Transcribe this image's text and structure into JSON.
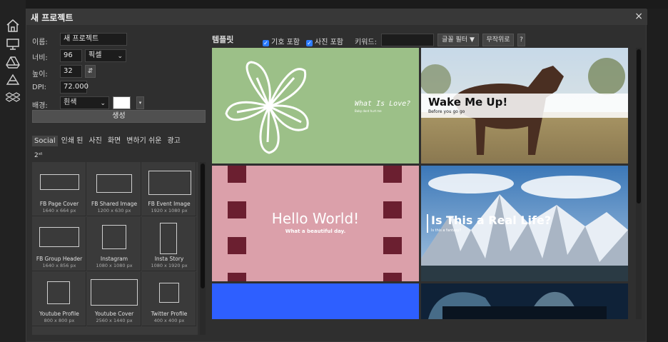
{
  "sidebar": {
    "icons": [
      "home-icon",
      "monitor-icon",
      "drive-icon",
      "drive-outline-icon",
      "dropbox-icon"
    ]
  },
  "dialog": {
    "title": "새 프로젝트",
    "close": "×"
  },
  "form": {
    "name_label": "이름:",
    "name_value": "새 프로젝트",
    "width_label": "너비:",
    "width_value": "96",
    "unit_value": "픽셀",
    "height_label": "높이:",
    "height_value": "32",
    "swap_icon": "⇵",
    "dpi_label": "DPI:",
    "dpi_value": "72.000",
    "bg_label": "배경:",
    "bg_value": "흰색",
    "bg_color": "#ffffff",
    "create_label": "생성"
  },
  "tabs": [
    {
      "label": "Social",
      "active": true
    },
    {
      "label": "인쇄 된",
      "active": false
    },
    {
      "label": "사진",
      "active": false
    },
    {
      "label": "화면",
      "active": false
    },
    {
      "label": "변하기 쉬운",
      "active": false
    },
    {
      "label": "광고",
      "active": false
    },
    {
      "label": "2ˢᵗ",
      "active": false
    }
  ],
  "presets": [
    {
      "name": "FB Page Cover",
      "size": "1640 x 664 px"
    },
    {
      "name": "FB Shared Image",
      "size": "1200 x 630 px"
    },
    {
      "name": "FB Event Image",
      "size": "1920 x 1080 px"
    },
    {
      "name": "FB Group Header",
      "size": "1640 x 856 px"
    },
    {
      "name": "Instagram",
      "size": "1080 x 1080 px"
    },
    {
      "name": "Insta Story",
      "size": "1080 x 1920 px"
    },
    {
      "name": "Youtube Profile",
      "size": "800 x 800 px"
    },
    {
      "name": "Youtube Cover",
      "size": "2560 x 1440 px"
    },
    {
      "name": "Twitter Profile",
      "size": "400 x 400 px"
    }
  ],
  "templates_bar": {
    "title": "템플릿",
    "include_symbols": "기호 포함",
    "include_photos": "사진 포함",
    "keyword_label": "키워드:",
    "keyword_value": "",
    "font_filter": "글꼴 필터 ▼",
    "random": "무작위로",
    "help": "?"
  },
  "templates": [
    {
      "title": "What Is Love?",
      "subtitle": "Baby dont hurt me",
      "bg": "#9cc088"
    },
    {
      "title": "Wake Me Up!",
      "subtitle": "Before you go go"
    },
    {
      "title": "Hello World!",
      "subtitle": "What a beautiful day.",
      "bg": "#dba0aa"
    },
    {
      "title": "Is This a Real Life?",
      "subtitle": "Is this a fantasy?"
    },
    {
      "title": "",
      "subtitle": "",
      "bg": "#2e5fff"
    },
    {
      "title": "",
      "subtitle": ""
    }
  ]
}
